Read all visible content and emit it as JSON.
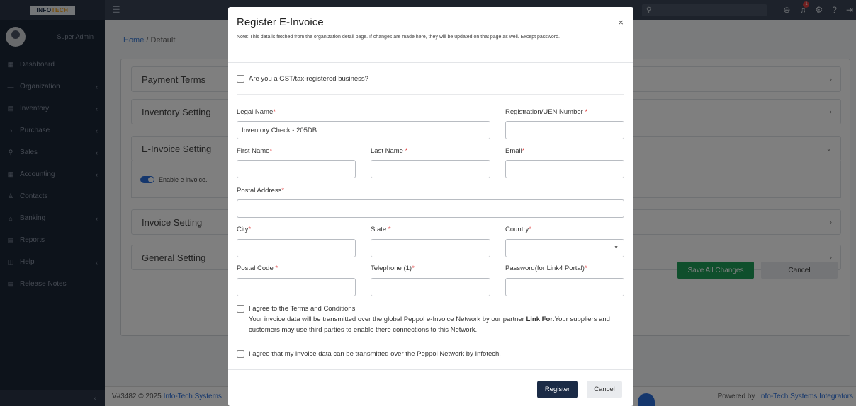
{
  "app": {
    "logo_main": "INFO",
    "logo_accent": "TECH",
    "user_name": "Super Admin",
    "version": "V#3482",
    "copyright": "© 2025",
    "company_link": "Info-Tech Systems",
    "powered_by": "Powered by",
    "powered_link": "Info-Tech Systems Integrators"
  },
  "sidebar": {
    "items": [
      {
        "label": "Dashboard",
        "icon": "▦",
        "chevron": ""
      },
      {
        "label": "Organization",
        "icon": "—",
        "chevron": "‹"
      },
      {
        "label": "Inventory",
        "icon": "▤",
        "chevron": "‹"
      },
      {
        "label": "Purchase",
        "icon": "◔",
        "chevron": "‹"
      },
      {
        "label": "Sales",
        "icon": "⚲",
        "chevron": "‹"
      },
      {
        "label": "Accounting",
        "icon": "▦",
        "chevron": "‹"
      },
      {
        "label": "Contacts",
        "icon": "♙",
        "chevron": ""
      },
      {
        "label": "Banking",
        "icon": "⌂",
        "chevron": "‹"
      },
      {
        "label": "Reports",
        "icon": "▤",
        "chevron": ""
      },
      {
        "label": "Help",
        "icon": "◫",
        "chevron": "‹"
      },
      {
        "label": "Release Notes",
        "icon": "▤",
        "chevron": ""
      }
    ],
    "collapse": "‹"
  },
  "topbar": {
    "notif_count": "1"
  },
  "page": {
    "breadcrumb_home": "Home",
    "breadcrumb_sep": " / ",
    "breadcrumb_current": "Default",
    "sections": [
      "Payment Terms",
      "Inventory Setting",
      "E-Invoice Setting",
      "Invoice Setting",
      "General Setting"
    ],
    "einvoice_toggle_label": "Enable e invoice.",
    "save_label": "Save All Changes",
    "cancel_label": "Cancel"
  },
  "modal": {
    "title": "Register E-Invoice",
    "close": "×",
    "note": "Note: This data is fetched from the organization detail page. If changes are made here, they will be updated on that page as well. Except password.",
    "gst_question": "Are you a GST/tax-registered business?",
    "fields": {
      "legal_name": {
        "label": "Legal Name",
        "value": "Inventory Check - 205DB"
      },
      "uen": {
        "label": "Registration/UEN Number ",
        "value": ""
      },
      "first_name": {
        "label": "First Name",
        "value": ""
      },
      "last_name": {
        "label": "Last Name ",
        "value": ""
      },
      "email": {
        "label": "Email",
        "value": ""
      },
      "postal_address": {
        "label": "Postal Address",
        "value": ""
      },
      "city": {
        "label": "City",
        "value": ""
      },
      "state": {
        "label": "State ",
        "value": ""
      },
      "country": {
        "label": "Country",
        "value": ""
      },
      "postal_code": {
        "label": "Postal Code ",
        "value": ""
      },
      "telephone": {
        "label": "Telephone (1)",
        "value": ""
      },
      "password": {
        "label": "Password(for Link4 Portal)",
        "value": ""
      }
    },
    "required_mark": "*",
    "terms_label": "I agree to the Terms and Conditions",
    "terms_text_1": "Your invoice data will be transmitted over the global Peppol e-Invoice Network by our partner ",
    "terms_partner": "Link For",
    "terms_text_2": ".Your suppliers and customers may use third parties to enable there connections to this Network.",
    "peppol_consent": "I agree that my invoice data can be transmitted over the Peppol Network by Infotech.",
    "register_label": "Register",
    "cancel_label": "Cancel"
  }
}
